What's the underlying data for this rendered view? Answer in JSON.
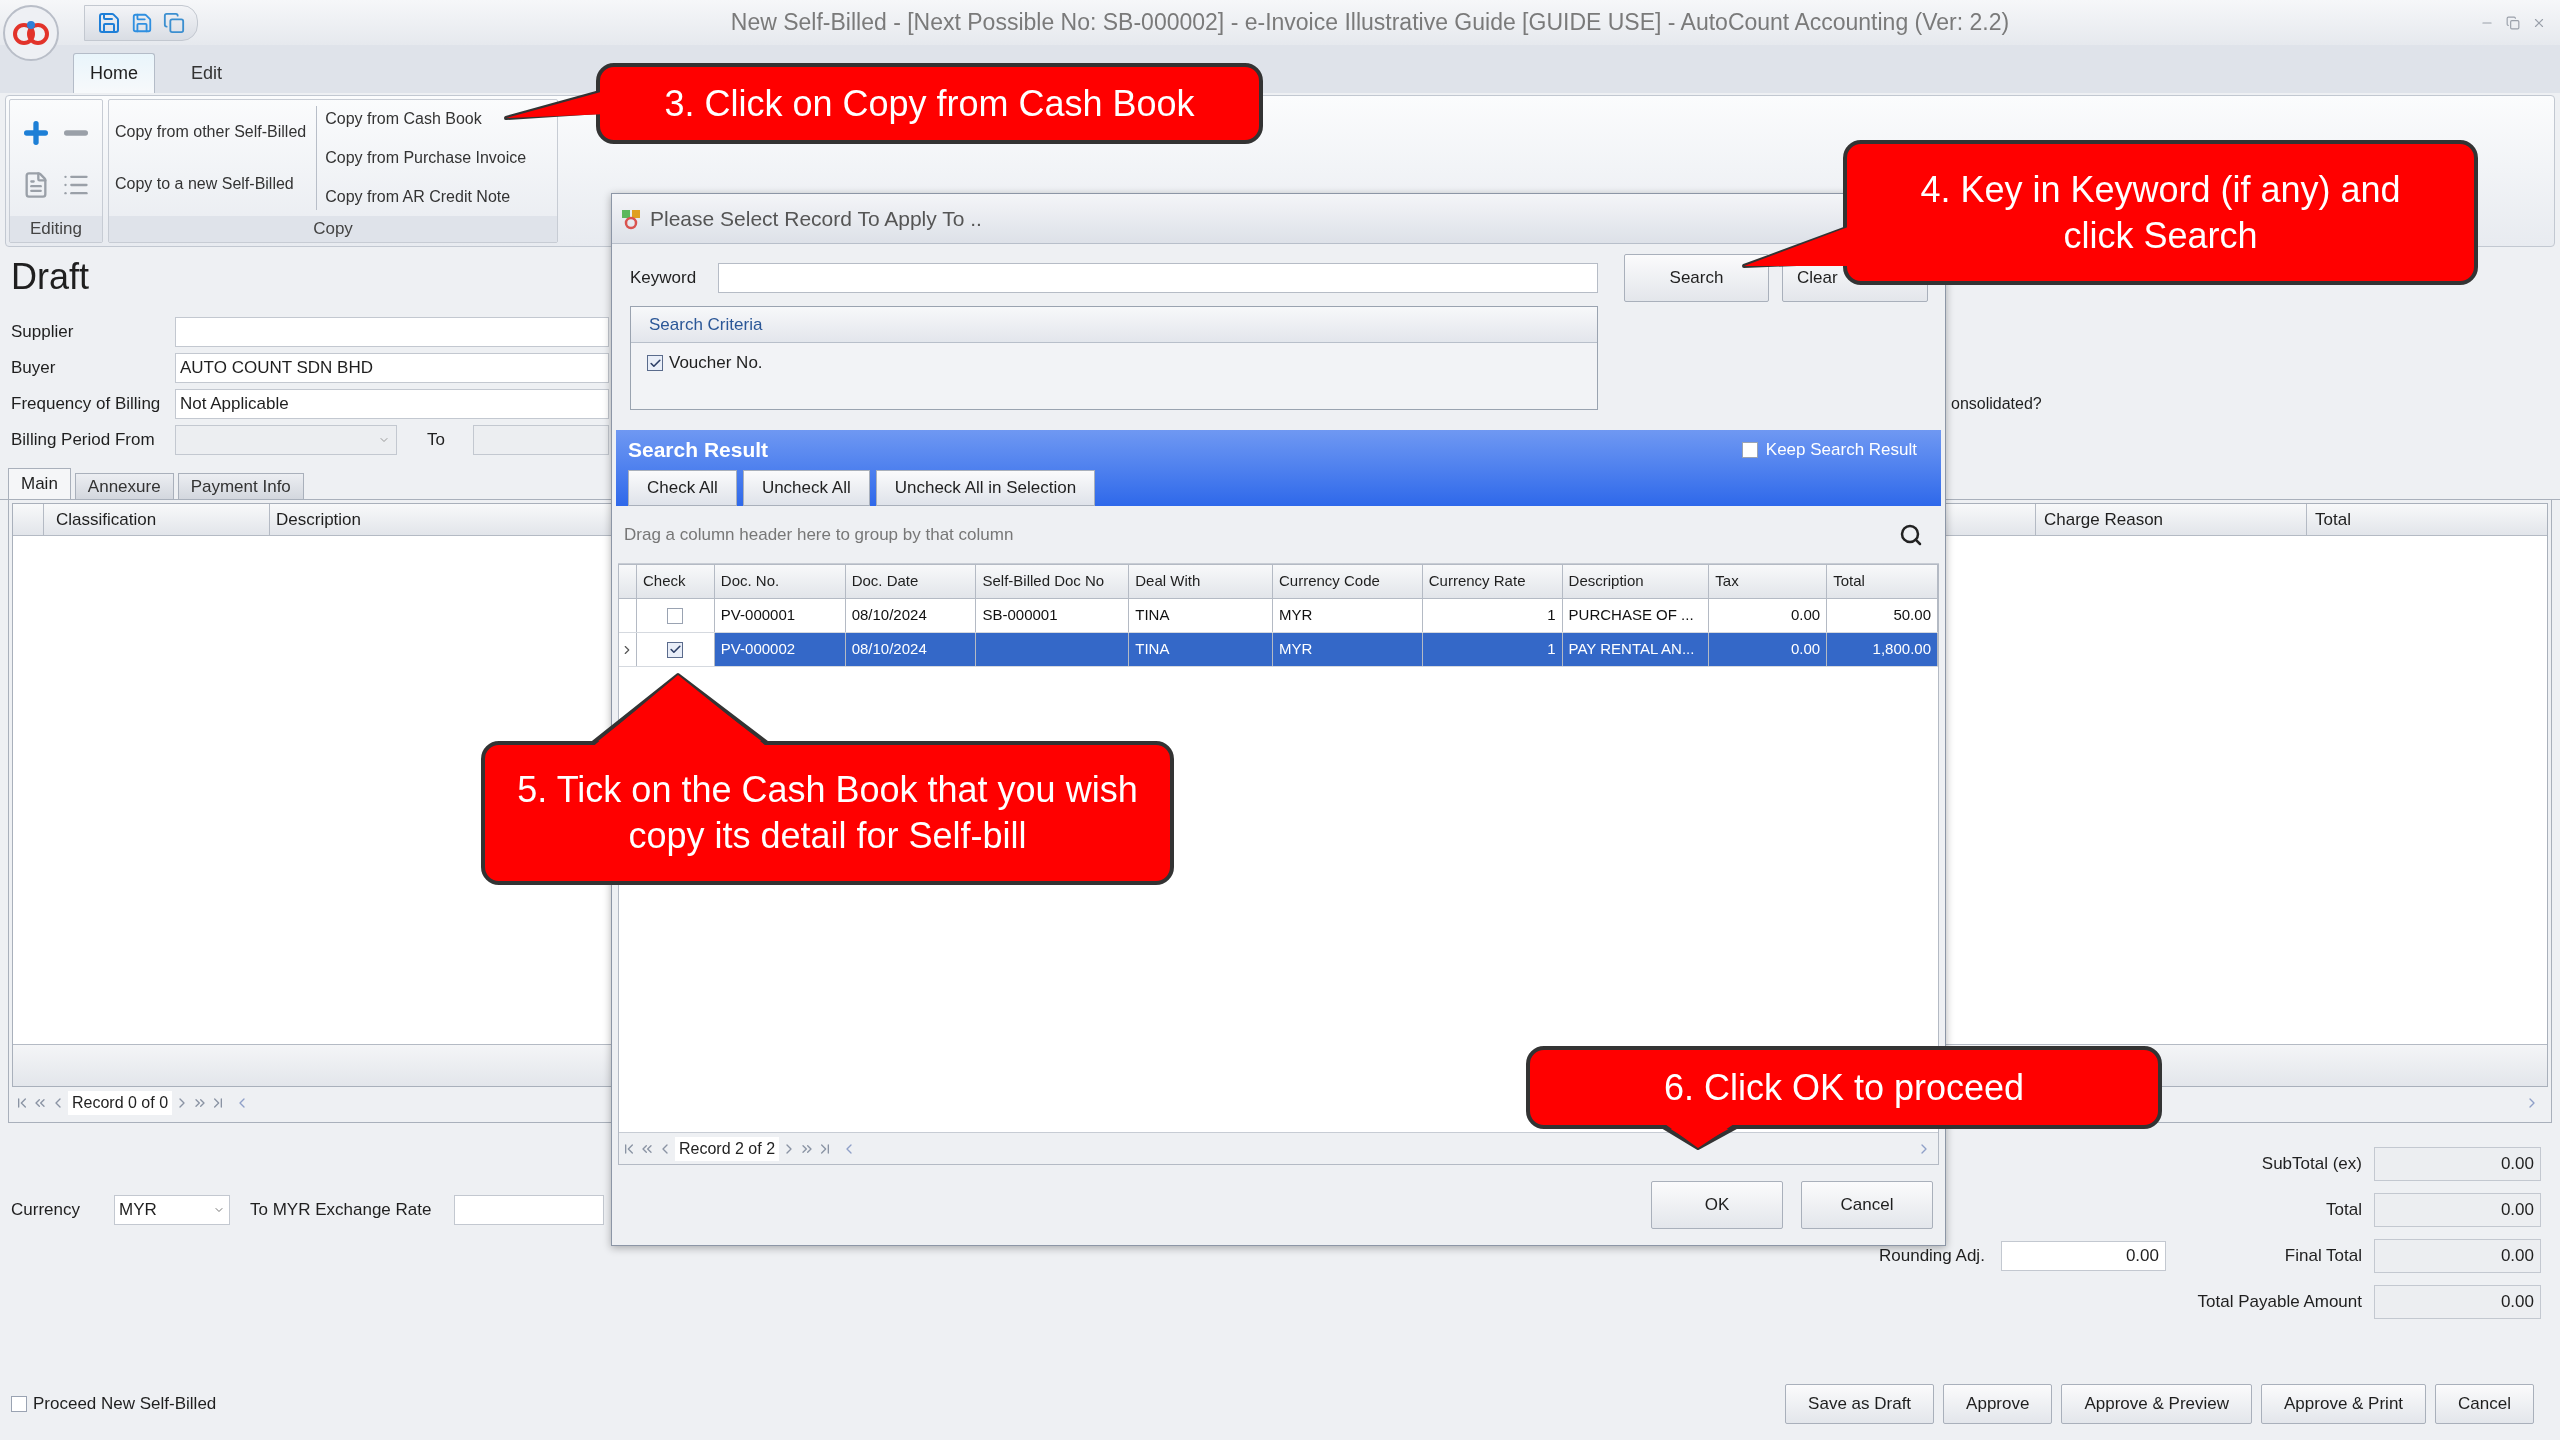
{
  "window": {
    "title": "New Self-Billed - [Next Possible No: SB-000002] - e-Invoice Illustrative Guide [GUIDE USE] - AutoCount Accounting (Ver: 2.2)"
  },
  "ribbon": {
    "tabs": [
      {
        "label": "Home",
        "selected": true
      },
      {
        "label": "Edit",
        "selected": false
      }
    ],
    "editing_group": {
      "label": "Editing"
    },
    "copy_group": {
      "label": "Copy",
      "self_billed_commands": [
        "Copy from other Self-Billed",
        "Copy to a new Self-Billed"
      ],
      "copy_from_commands": [
        "Copy from Cash Book",
        "Copy from Purchase Invoice",
        "Copy from AR Credit Note"
      ]
    }
  },
  "form": {
    "status": "Draft",
    "fields": [
      {
        "kind": "text",
        "label": "Supplier"
      },
      {
        "kind": "text",
        "label": "Buyer",
        "value": "AUTO COUNT SDN BHD"
      },
      {
        "kind": "text",
        "label": "Frequency of Billing",
        "value": "Not Applicable"
      },
      {
        "kind": "period",
        "label": "Billing Period From",
        "to_label": "To"
      }
    ],
    "consolidated_label": "onsolidated?"
  },
  "tabs": [
    {
      "label": "Main",
      "selected": true
    },
    {
      "label": "Annexure",
      "selected": false
    },
    {
      "label": "Payment Info",
      "selected": false
    }
  ],
  "detail_grid": {
    "columns_left": [
      "Classification",
      "Description"
    ],
    "columns_right": [
      "Charge Reason",
      "Total"
    ],
    "record_nav": "Record 0 of 0"
  },
  "currency": {
    "label": "Currency",
    "value": "MYR",
    "rate_label": "To MYR Exchange Rate"
  },
  "totals": [
    {
      "label": "SubTotal (ex)",
      "value": "0.00"
    },
    {
      "label": "Total",
      "value": "0.00"
    },
    {
      "label": "Final Total",
      "value": "0.00"
    },
    {
      "label": "Total Payable Amount",
      "value": "0.00"
    }
  ],
  "rounding": {
    "label": "Rounding Adj.",
    "value": "0.00"
  },
  "proceed_new": {
    "label": "Proceed New Self-Billed",
    "checked": false
  },
  "actions": [
    "Save as Draft",
    "Approve",
    "Approve & Preview",
    "Approve & Print",
    "Cancel"
  ],
  "dialog": {
    "title": "Please Select Record To Apply To ..",
    "keyword_label": "Keyword",
    "search_button": "Search",
    "clear_button": "Clear",
    "criteria": {
      "title": "Search Criteria",
      "options": [
        {
          "label": "Voucher No.",
          "checked": true
        }
      ]
    },
    "result_title": "Search Result",
    "keep_result": {
      "label": "Keep Search Result",
      "checked": false
    },
    "result_buttons": [
      "Check All",
      "Uncheck All",
      "Uncheck All in Selection"
    ],
    "group_hint": "Drag a column header here to group by that column",
    "columns": [
      "Check",
      "Doc. No.",
      "Doc. Date",
      "Self-Billed Doc No",
      "Deal With",
      "Currency Code",
      "Currency Rate",
      "Description",
      "Tax",
      "Total"
    ],
    "rows": [
      {
        "selected": false,
        "checked": false,
        "doc_no": "PV-000001",
        "doc_date": "08/10/2024",
        "self_billed_doc_no": "SB-000001",
        "deal_with": "TINA",
        "currency_code": "MYR",
        "currency_rate": "1",
        "description": "PURCHASE OF ...",
        "tax": "0.00",
        "total": "50.00"
      },
      {
        "selected": true,
        "checked": true,
        "doc_no": "PV-000002",
        "doc_date": "08/10/2024",
        "deal_with": "TINA",
        "currency_code": "MYR",
        "currency_rate": "1",
        "description": "PAY RENTAL AN...",
        "tax": "0.00",
        "total": "1,800.00"
      }
    ],
    "record_nav": "Record 2 of 2",
    "buttons": [
      "OK",
      "Cancel"
    ]
  },
  "callouts": [
    {
      "text": "3. Click on Copy from Cash Book"
    },
    {
      "text": "4. Key in Keyword (if any) and click Search"
    },
    {
      "text": "5. Tick on the Cash Book that you wish copy its detail for Self-bill"
    },
    {
      "text": "6. Click OK to proceed"
    }
  ]
}
